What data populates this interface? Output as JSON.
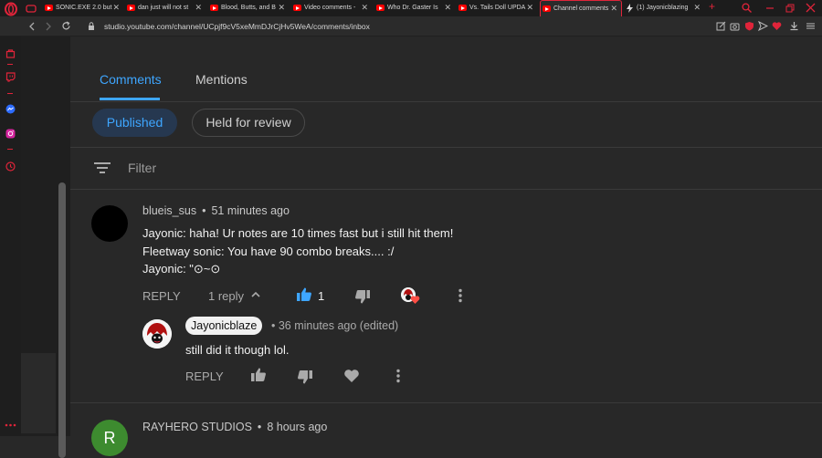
{
  "browser": {
    "tabs": [
      {
        "title": "SONIC.EXE 2.0 but"
      },
      {
        "title": "dan just will not st"
      },
      {
        "title": "Blood, Butts, and B"
      },
      {
        "title": "Video comments -"
      },
      {
        "title": "Who Dr. Gaster Is"
      },
      {
        "title": "Vs. Tails Doll UPDA"
      },
      {
        "title": "Channel comments"
      },
      {
        "title": "(1) Jayonicblazing"
      }
    ],
    "new_tab": "+",
    "url": "studio.youtube.com/channel/UCpjf9cV5xeMmDJrCjHv5WeA/comments/inbox"
  },
  "page": {
    "tabs": [
      {
        "label": "Comments",
        "active": true
      },
      {
        "label": "Mentions",
        "active": false
      }
    ],
    "chips": [
      {
        "label": "Published",
        "selected": true
      },
      {
        "label": "Held for review",
        "selected": false
      }
    ],
    "filter_placeholder": "Filter"
  },
  "comment": {
    "author": "blueis_sus",
    "time": "51 minutes ago",
    "lines": [
      "Jayonic: haha! Ur notes are 10 times fast but i still hit them!",
      "Fleetway sonic: You have 90 combo breaks.... :/",
      "Jayonic:  \"⊙~⊙"
    ],
    "reply_label": "REPLY",
    "replies_label": "1 reply",
    "likes": "1"
  },
  "reply": {
    "author": "Jayonicblaze",
    "meta": "36 minutes ago (edited)",
    "text": "still did it though lol.",
    "reply_label": "REPLY"
  },
  "next_comment": {
    "avatar_letter": "R",
    "author": "RAYHERO STUDIOS",
    "time": "8 hours ago"
  },
  "colors": {
    "accent": "#3ea6ff",
    "chip_bg": "#263850",
    "opera_red": "#e0243a",
    "yt_red": "#ff0000"
  }
}
